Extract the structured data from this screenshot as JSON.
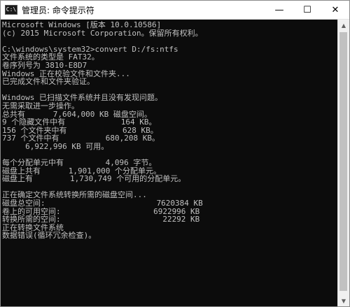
{
  "window": {
    "title": "管理员: 命令提示符",
    "icon": "cmd-icon",
    "controls": {
      "minimize": "—",
      "maximize": "☐",
      "close": "✕"
    }
  },
  "console": {
    "lines": [
      "Microsoft Windows [版本 10.0.10586]",
      "(c) 2015 Microsoft Corporation。保留所有权利。",
      "",
      "C:\\windows\\system32>convert D:/fs:ntfs",
      "文件系统的类型是 FAT32。",
      "卷序列号为 3810-E8D7",
      "Windows 正在校验文件和文件夹...",
      "已完成文件和文件夹验证。",
      "",
      "Windows 已扫描文件系统并且没有发现问题。",
      "无需采取进一步操作。",
      "总共有      7,604,000 KB 磁盘空间。",
      "9 个隐藏文件中有            164 KB。",
      "156 个文件夹中有            628 KB。",
      "737 个文件中有          680,208 KB。",
      "     6,922,996 KB 可用。",
      "",
      "每个分配单元中有         4,096 字节。",
      "磁盘上共有      1,901,000 个分配单元。",
      "磁盘上有        1,730,749 个可用的分配单元。",
      "",
      "正在确定文件系统转换所需的磁盘空间...",
      "磁盘总空间:                        7620384 KB",
      "卷上的可用空间:                    6922996 KB",
      "转换所需的空间:                      22292 KB",
      "正在转换文件系统",
      "数据错误(循环冗余检查)。"
    ],
    "colors": {
      "background": "#0c0c0c",
      "text": "#c0c0c0"
    }
  },
  "scrollbar": {
    "up_arrow": "▲",
    "down_arrow": "▼"
  }
}
